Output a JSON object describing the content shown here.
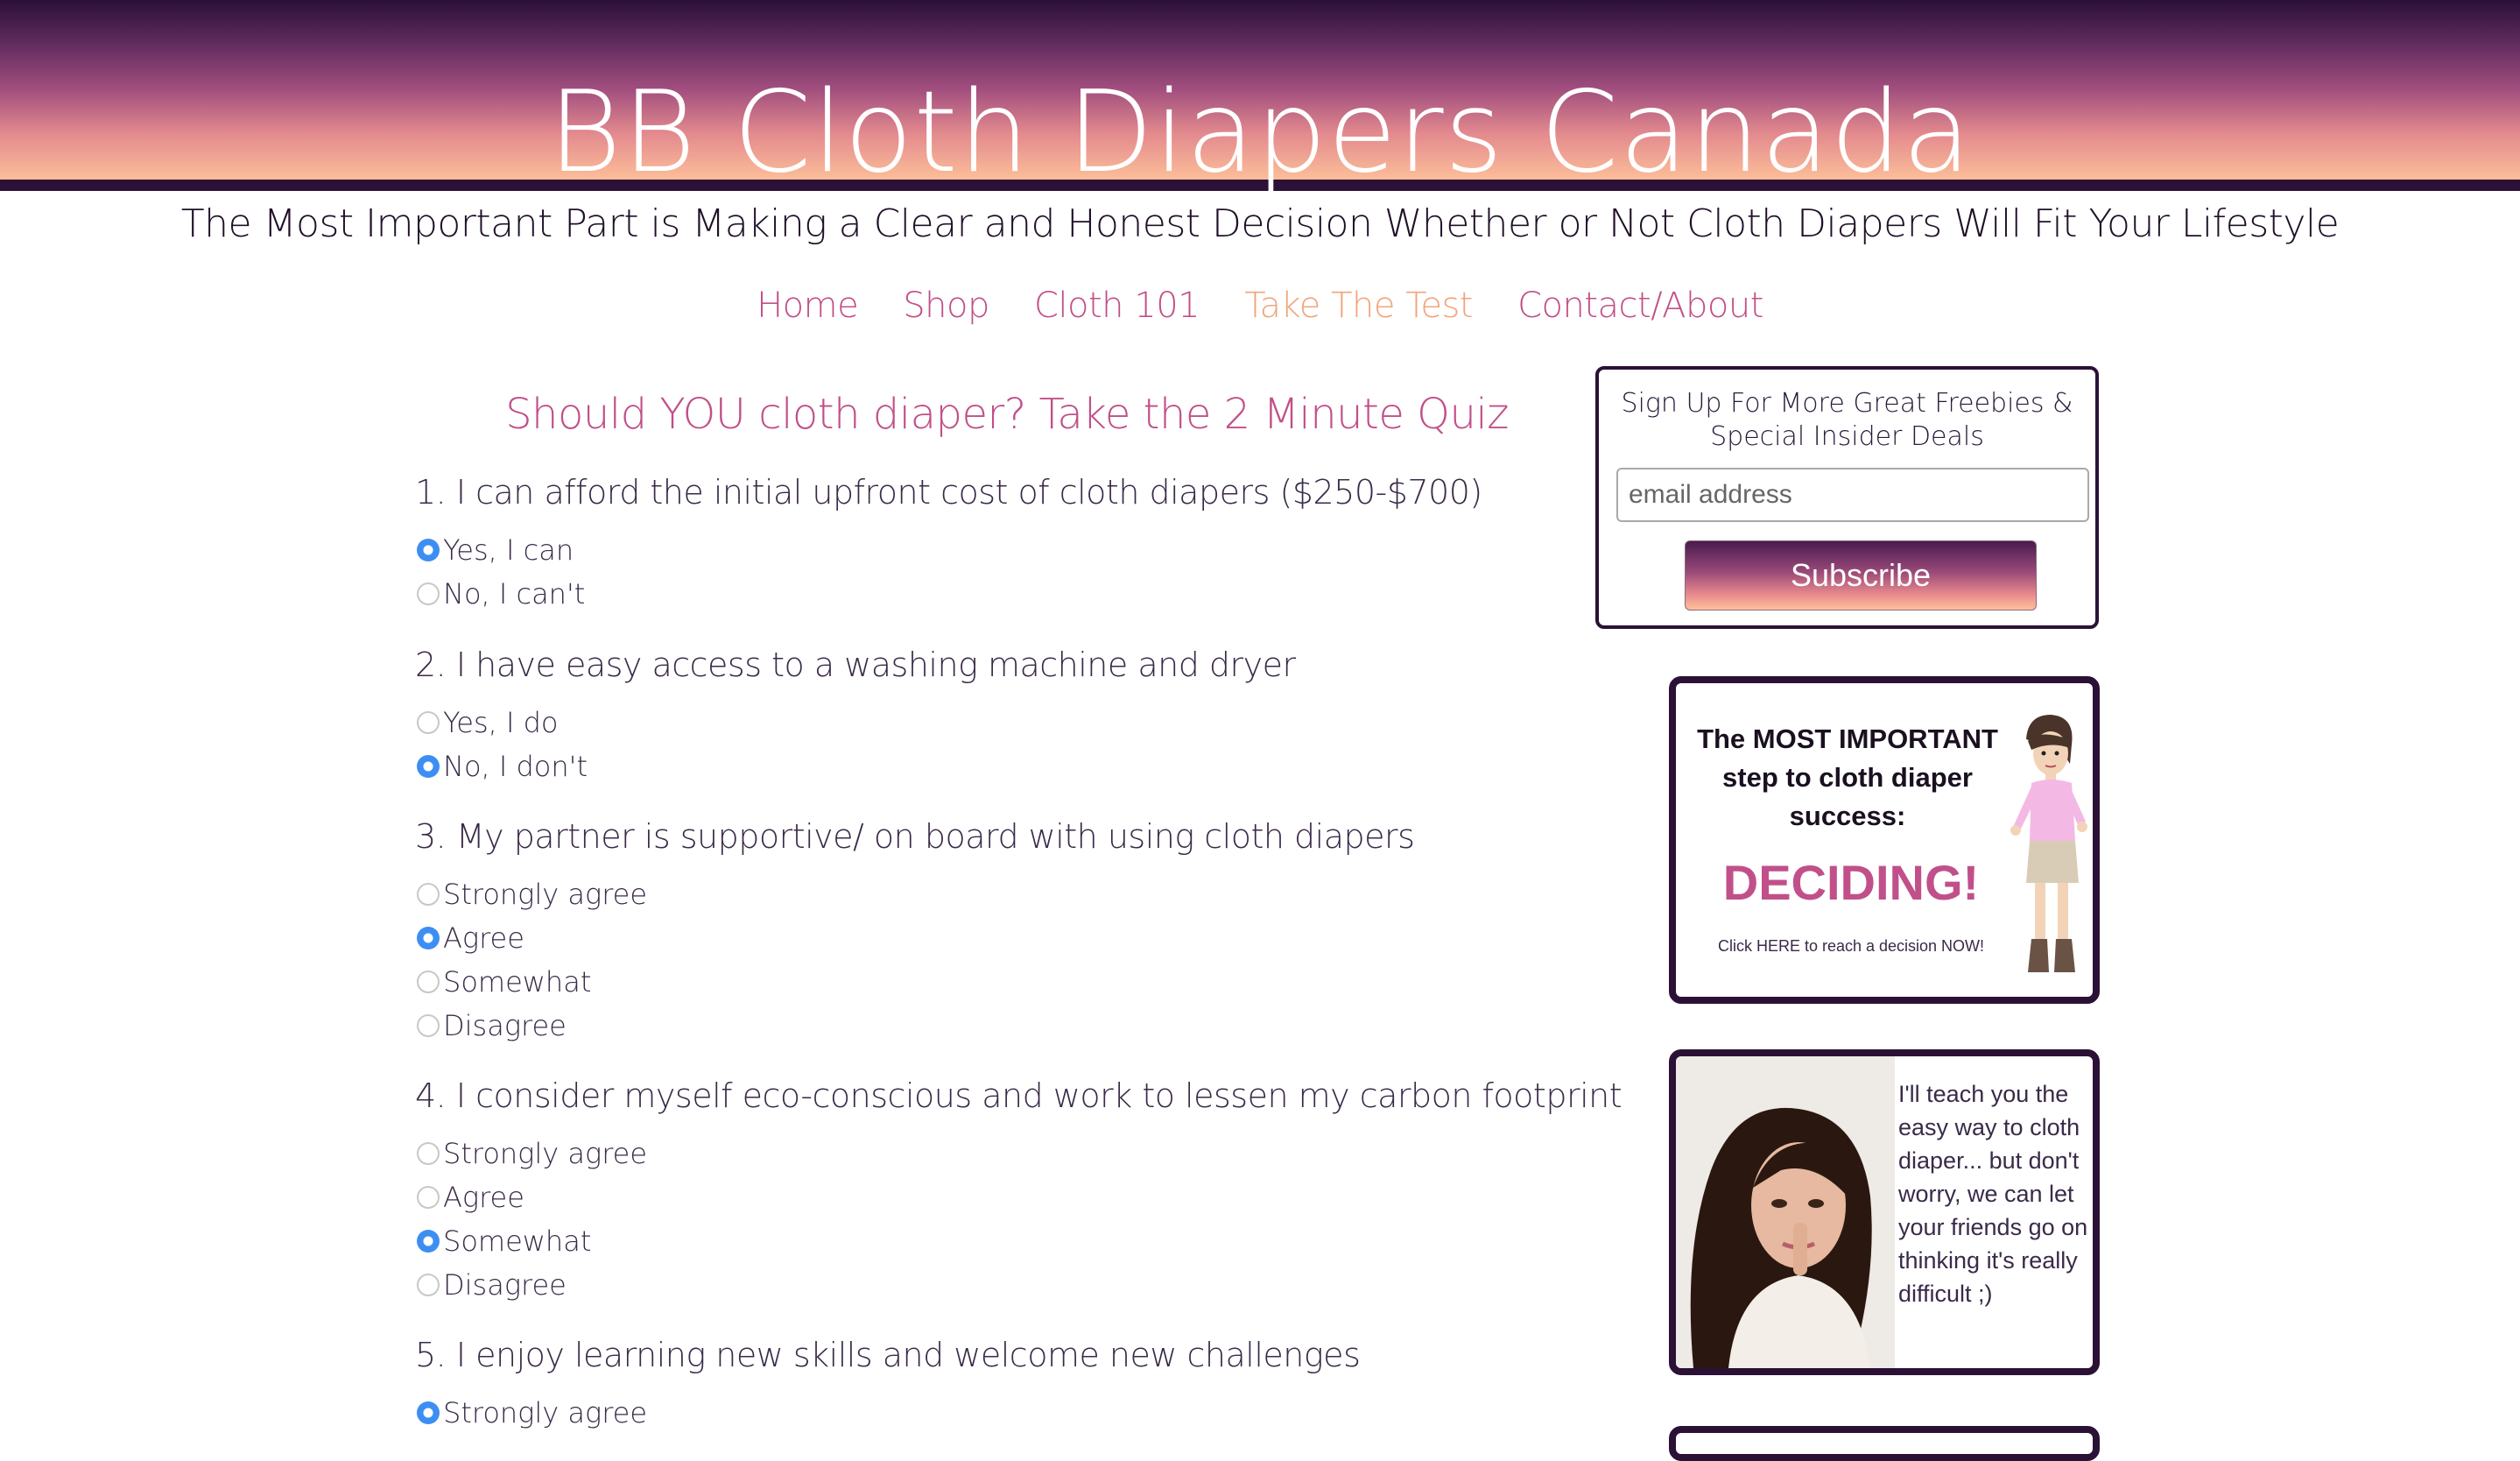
{
  "site": {
    "title": "BB Cloth Diapers Canada",
    "tagline": "The Most Important Part is Making a Clear and Honest Decision Whether or Not Cloth Diapers Will Fit Your Lifestyle"
  },
  "nav": {
    "items": [
      {
        "label": "Home"
      },
      {
        "label": "Shop"
      },
      {
        "label": "Cloth 101"
      },
      {
        "label": "Take The Test",
        "active": true
      },
      {
        "label": "Contact/About"
      }
    ]
  },
  "quiz": {
    "title": "Should YOU cloth diaper? Take the 2 Minute Quiz",
    "questions": [
      {
        "text": "1. I can afford the initial upfront cost of cloth diapers ($250-$700)",
        "options": [
          {
            "label": "Yes, I can",
            "checked": true
          },
          {
            "label": "No, I can't",
            "checked": false
          }
        ]
      },
      {
        "text": "2. I have easy access to a washing machine and dryer",
        "options": [
          {
            "label": "Yes, I do",
            "checked": false
          },
          {
            "label": "No, I don't",
            "checked": true
          }
        ]
      },
      {
        "text": "3. My partner is supportive/ on board with using cloth diapers",
        "options": [
          {
            "label": "Strongly agree",
            "checked": false
          },
          {
            "label": "Agree",
            "checked": true
          },
          {
            "label": "Somewhat",
            "checked": false
          },
          {
            "label": "Disagree",
            "checked": false
          }
        ]
      },
      {
        "text": "4. I consider myself eco-conscious and work to lessen my carbon footprint",
        "options": [
          {
            "label": "Strongly agree",
            "checked": false
          },
          {
            "label": "Agree",
            "checked": false
          },
          {
            "label": "Somewhat",
            "checked": true
          },
          {
            "label": "Disagree",
            "checked": false
          }
        ]
      },
      {
        "text": "5. I enjoy learning new skills and welcome new challenges",
        "options": [
          {
            "label": "Strongly agree",
            "checked": true
          }
        ]
      }
    ]
  },
  "signup": {
    "text": "Sign Up For More Great Freebies & Special Insider Deals",
    "email_placeholder": "email address",
    "button_label": "Subscribe"
  },
  "promo1": {
    "line1": "The MOST IMPORTANT step to cloth diaper success:",
    "headline": "DECIDING!",
    "cta": "Click HERE to reach a decision NOW!"
  },
  "promo2": {
    "text": "I'll teach you the easy way to cloth diaper... but don't worry, we can let your friends go on thinking it's really difficult ;)"
  },
  "colors": {
    "accent_pink": "#c14f88",
    "active_nav": "#f0a57c",
    "dark_purple": "#2c1136",
    "radio_checked": "#3d8ef3"
  }
}
